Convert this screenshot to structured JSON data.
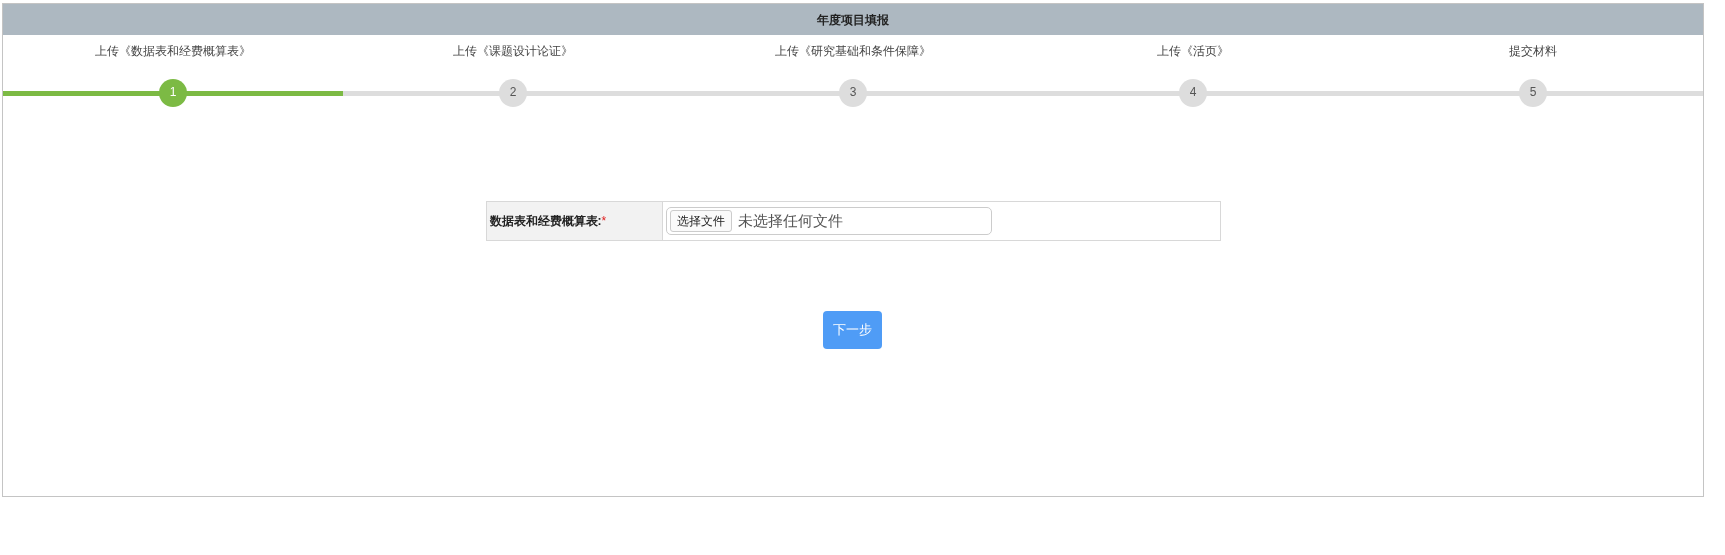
{
  "header": {
    "title": "年度项目填报"
  },
  "steps": [
    {
      "label": "上传《数据表和经费概算表》",
      "number": "1",
      "selected": true
    },
    {
      "label": "上传《课题设计论证》",
      "number": "2",
      "selected": false
    },
    {
      "label": "上传《研究基础和条件保障》",
      "number": "3",
      "selected": false
    },
    {
      "label": "上传《活页》",
      "number": "4",
      "selected": false
    },
    {
      "label": "提交材料",
      "number": "5",
      "selected": false
    }
  ],
  "form": {
    "label": "数据表和经费概算表:",
    "required_mark": "*",
    "file_button": "选择文件",
    "file_status": "未选择任何文件"
  },
  "next_button": "下一步"
}
